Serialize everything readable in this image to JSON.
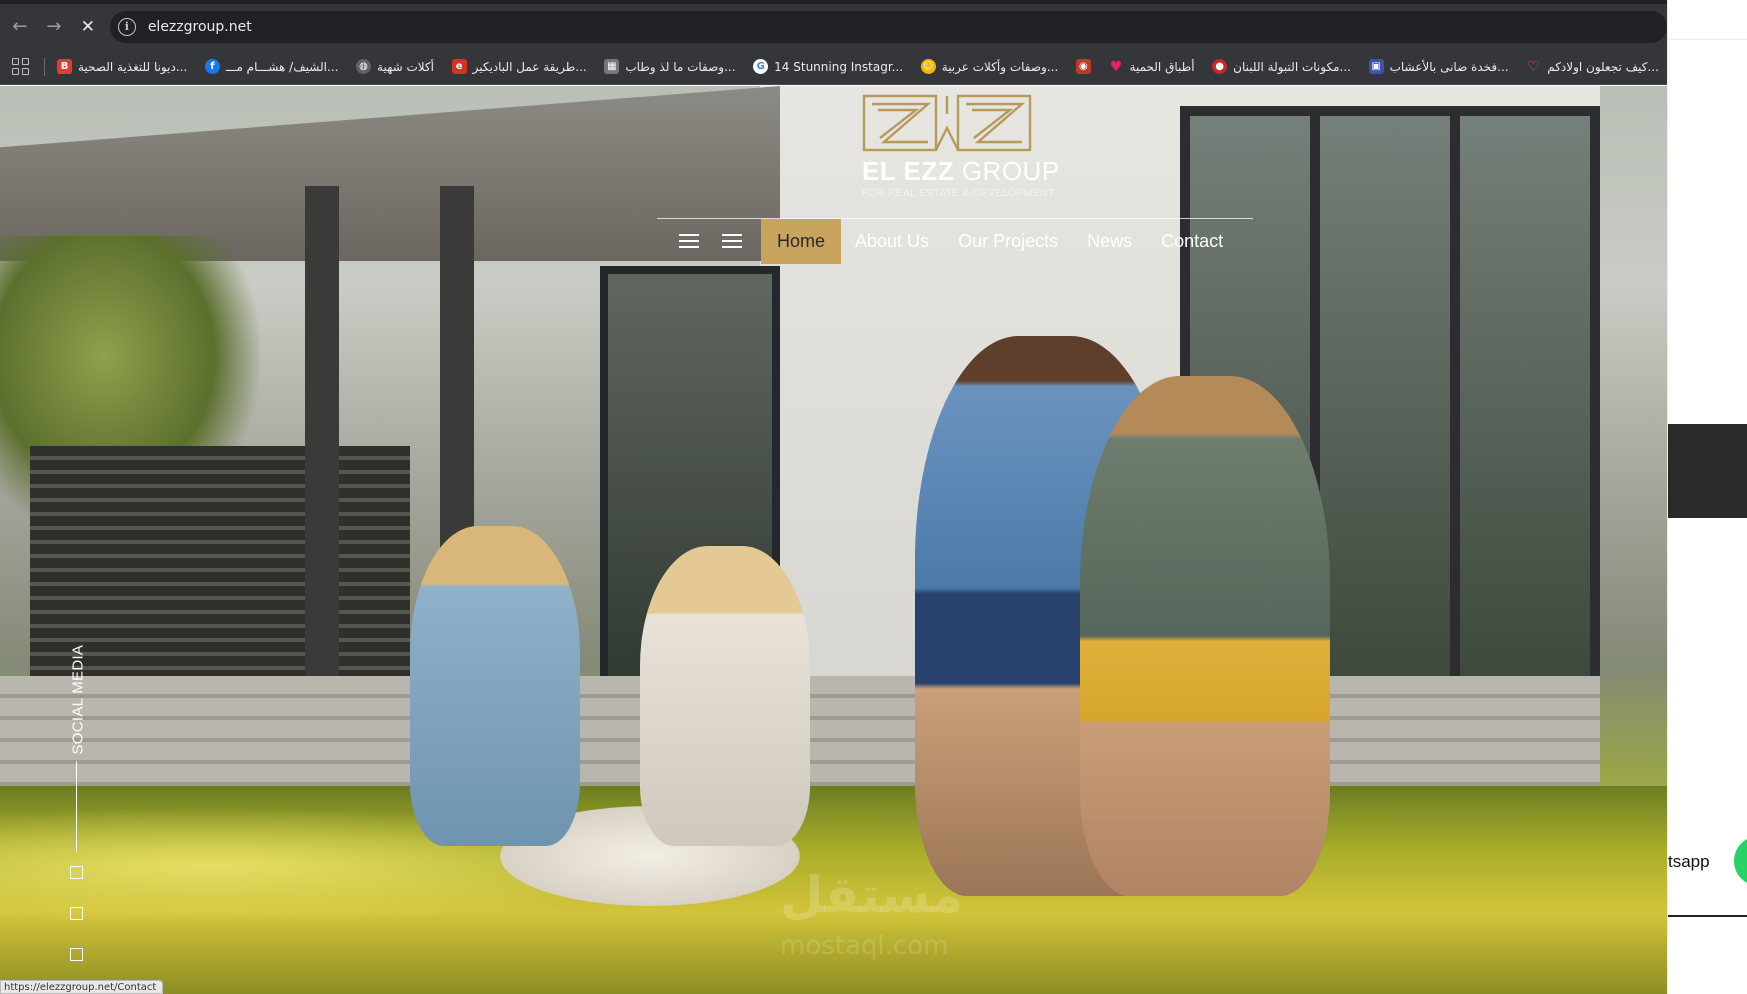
{
  "browser": {
    "url": "elezzgroup.net",
    "status_url": "https://elezzgroup.net/Contact",
    "nav_icons": [
      "back-arrow-icon",
      "forward-arrow-icon",
      "stop-icon",
      "site-info-icon"
    ],
    "bookmarks": [
      {
        "label": "ديونا للتغذية الصحية...",
        "icon": "b-icon",
        "color": "#e53935",
        "glyph": "B"
      },
      {
        "label": "الشيف/ هشـــام مـــ...",
        "icon": "facebook-icon",
        "color": "#1877f2",
        "glyph": "f"
      },
      {
        "label": "أكلات شهية",
        "icon": "globe-icon",
        "color": "#5f6368",
        "glyph": "◍"
      },
      {
        "label": "طريقة عمل الباديكير...",
        "icon": "red-e-icon",
        "color": "#d93025",
        "glyph": "e"
      },
      {
        "label": "وصفات ما لذ وطاب...",
        "icon": "qr-icon",
        "color": "#777777",
        "glyph": "▦"
      },
      {
        "label": "14 Stunning Instagr...",
        "icon": "google-icon",
        "color": "#4285f4",
        "glyph": "G"
      },
      {
        "label": "وصفات وأكلات عربية...",
        "icon": "chef-icon",
        "color": "#f4b400",
        "glyph": "☺"
      },
      {
        "label": "",
        "icon": "food-icon",
        "color": "#c0392b",
        "glyph": "◉"
      },
      {
        "label": "أطباق الحمية",
        "icon": "heart-icon",
        "color": "#e91e63",
        "glyph": "♥"
      },
      {
        "label": "مكونات التبولة اللبنان...",
        "icon": "red-circle-icon",
        "color": "#c62828",
        "glyph": "●"
      },
      {
        "label": "فخدة ضانى بالأعشاب...",
        "icon": "pic-icon",
        "color": "#3f51b5",
        "glyph": "▣"
      },
      {
        "label": "كيف تجعلون اولادكم...",
        "icon": "pink-heart-icon",
        "color": "#ec407a",
        "glyph": "♡"
      }
    ]
  },
  "site": {
    "logo": {
      "brand_bold": "EL EZZ",
      "brand_light": "GROUP",
      "tagline": "FOR REAL ESTATE & DEVELOPMENT",
      "gold": "#b59a5b"
    },
    "nav": {
      "items": [
        {
          "label": "Home",
          "active": true
        },
        {
          "label": "About Us"
        },
        {
          "label": "Our Projects"
        },
        {
          "label": "News"
        },
        {
          "label": "Contact"
        }
      ],
      "active_color": "#c8a45e"
    },
    "social": {
      "label": "SOCIAL MEDIA"
    },
    "watermark": {
      "main": "مستقل",
      "sub": "mostaql.com"
    }
  },
  "right_fragment": {
    "whatsapp_label": "tsapp",
    "whatsapp_color": "#25d366"
  }
}
